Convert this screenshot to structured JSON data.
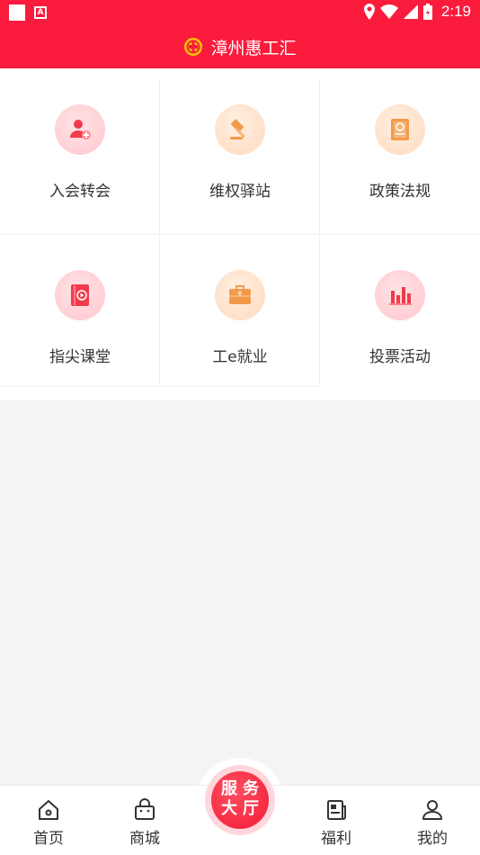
{
  "status_bar": {
    "time": "2:19"
  },
  "app": {
    "title": "漳州惠工汇"
  },
  "services": [
    {
      "label": "入会转会",
      "icon": "user-add-icon",
      "tone": "red"
    },
    {
      "label": "维权驿站",
      "icon": "gavel-icon",
      "tone": "orange"
    },
    {
      "label": "政策法规",
      "icon": "policy-book-icon",
      "tone": "orange"
    },
    {
      "label": "指尖课堂",
      "icon": "video-book-icon",
      "tone": "red"
    },
    {
      "label": "工e就业",
      "icon": "briefcase-icon",
      "tone": "orange"
    },
    {
      "label": "投票活动",
      "icon": "bar-chart-icon",
      "tone": "red"
    }
  ],
  "tabbar": {
    "home": "首页",
    "mall": "商城",
    "service_hall": [
      "服",
      "务",
      "大",
      "厅"
    ],
    "welfare": "福利",
    "mine": "我的"
  },
  "colors": {
    "brand_red": "#fb1b3c",
    "orange": "#f39a4a"
  }
}
